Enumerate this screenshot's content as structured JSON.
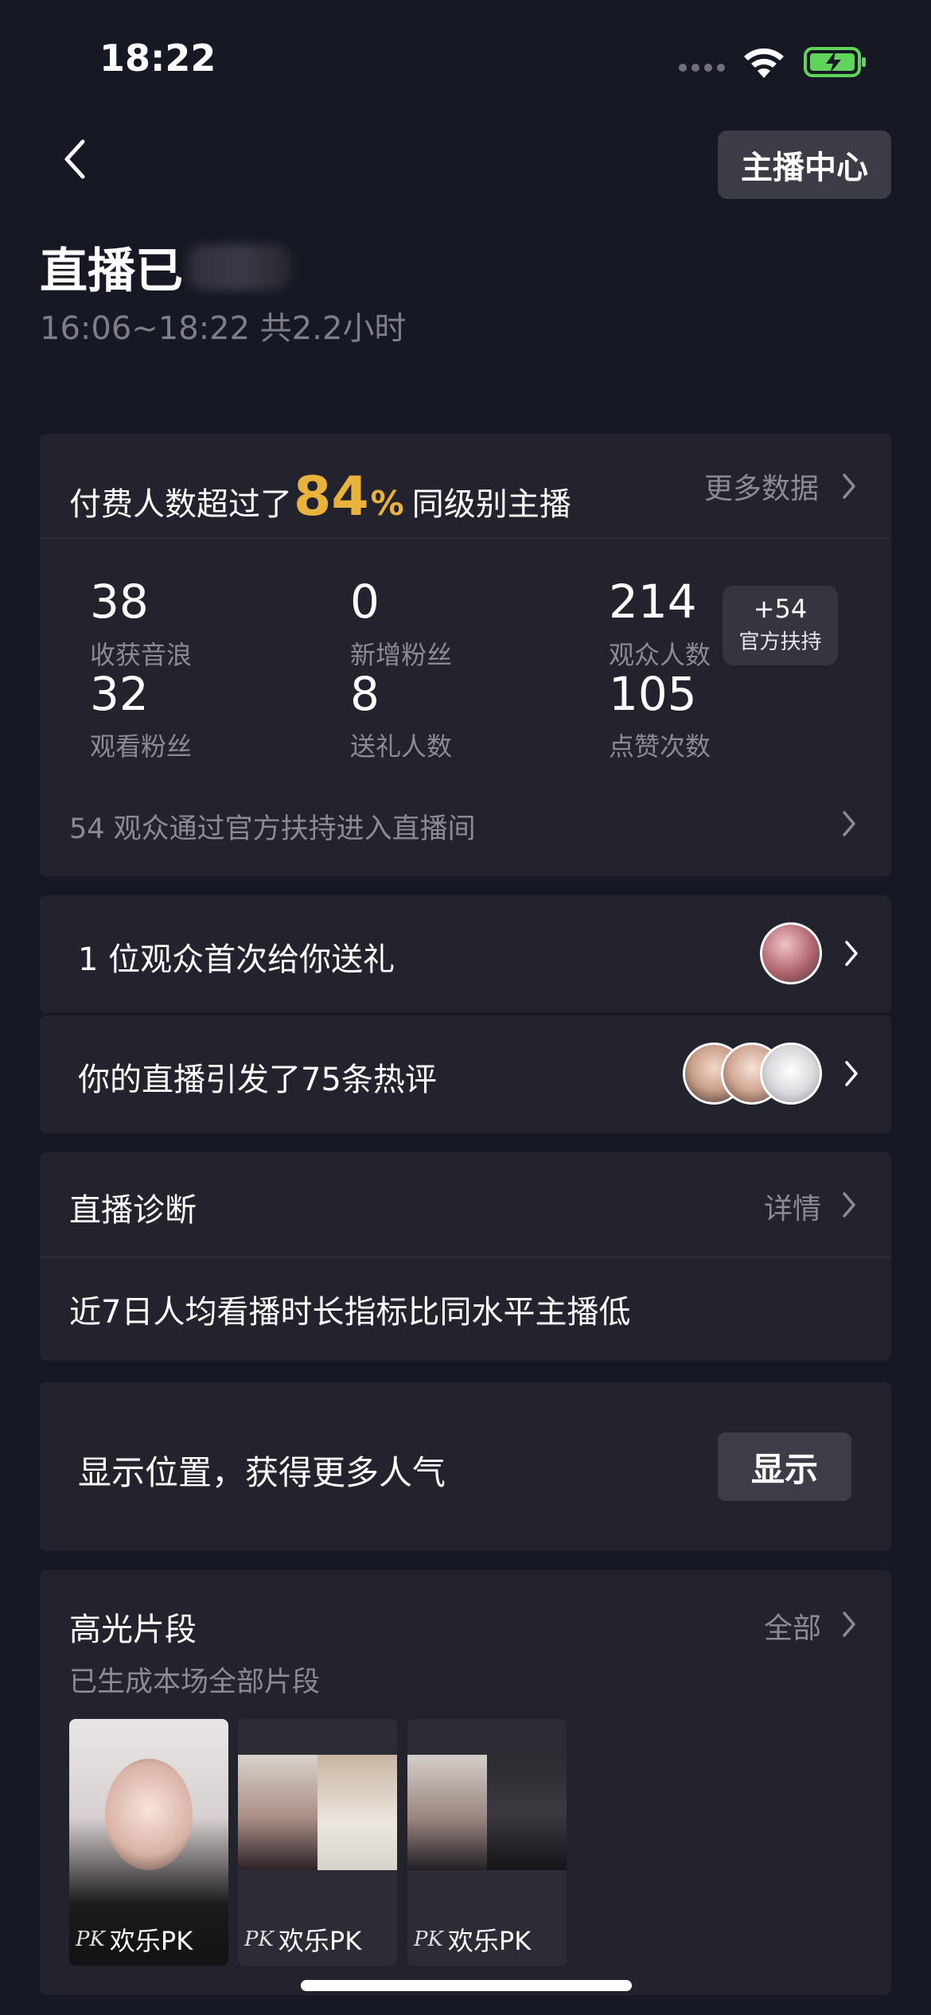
{
  "status_bar": {
    "time": "18:22"
  },
  "header": {
    "back_icon": "chevron-left-icon",
    "host_center_label": "主播中心"
  },
  "live": {
    "title": "直播已",
    "time_range": "16:06~18:22 共2.2小时"
  },
  "summary": {
    "prefix": "付费人数超过了",
    "percent_number": "84",
    "percent_sign": "%",
    "suffix": "同级别主播",
    "more_data_label": "更多数据",
    "stats": [
      {
        "value": "38",
        "label": "收获音浪"
      },
      {
        "value": "0",
        "label": "新增粉丝"
      },
      {
        "value": "214",
        "label": "观众人数"
      },
      {
        "value": "32",
        "label": "观看粉丝"
      },
      {
        "value": "8",
        "label": "送礼人数"
      },
      {
        "value": "105",
        "label": "点赞次数"
      }
    ],
    "badge_value": "+54",
    "badge_label": "官方扶持",
    "support_text": "54 观众通过官方扶持进入直播间",
    "accent_color": "#e8b23b"
  },
  "gift_row": {
    "text": "1 位观众首次给你送礼"
  },
  "comments_row": {
    "text": "你的直播引发了75条热评"
  },
  "diagnosis": {
    "title": "直播诊断",
    "detail_label": "详情",
    "message": "近7日人均看播时长指标比同水平主播低"
  },
  "location": {
    "text": "显示位置，获得更多人气",
    "button_label": "显示"
  },
  "highlights": {
    "title": "高光片段",
    "all_label": "全部",
    "subtitle": "已生成本场全部片段",
    "clips": [
      {
        "mark": "PK",
        "label": "欢乐PK"
      },
      {
        "mark": "PK",
        "label": "欢乐PK"
      },
      {
        "mark": "PK",
        "label": "欢乐PK"
      }
    ]
  }
}
